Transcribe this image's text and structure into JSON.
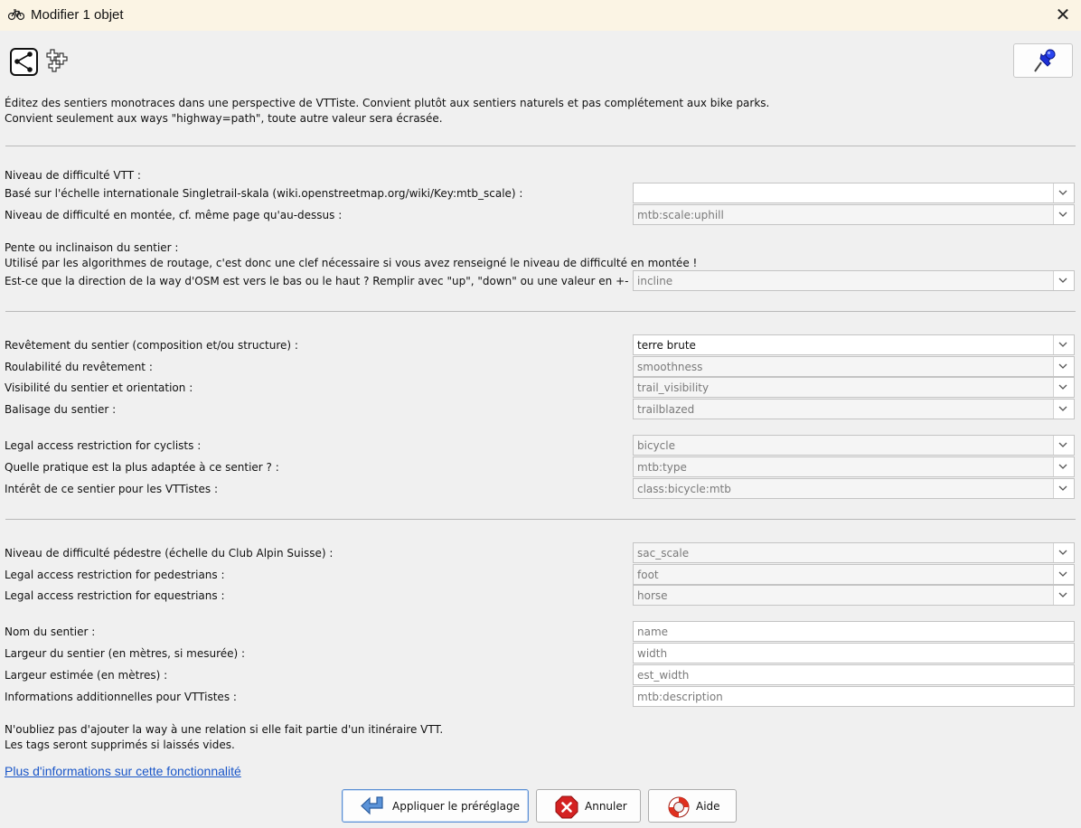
{
  "window": {
    "title": "Modifier 1 objet",
    "close_glyph": "✕",
    "icon": "bicycle-icon"
  },
  "toolbar": {
    "icons": [
      "way-nodes-icon",
      "add-tags-icon"
    ],
    "pin_icon": "pushpin-icon"
  },
  "description": {
    "line1": "Éditez des sentiers monotraces dans une perspective de VTTiste. Convient plutôt aux sentiers naturels et pas complétement aux bike parks.",
    "line2": "Convient seulement aux ways \"highway=path\", toute autre valeur sera écrasée."
  },
  "section_vtt": {
    "heading": "Niveau de difficulté VTT :",
    "mtb_scale": {
      "label": "Basé sur l'échelle internationale Singletrail-skala (wiki.openstreetmap.org/wiki/Key:mtb_scale) :",
      "value": ""
    },
    "mtb_uphill": {
      "label": "Niveau de difficulté en montée, cf. même page qu'au-dessus :",
      "placeholder": "mtb:scale:uphill"
    }
  },
  "section_incline": {
    "heading": "Pente ou inclinaison du sentier :",
    "note": "Utilisé par les algorithmes de routage, c'est donc une clef nécessaire si vous avez renseigné le niveau de difficulté en montée !",
    "incline": {
      "label": "Est-ce que la direction de la way d'OSM est vers le bas ou le haut ? Remplir avec \"up\", \"down\" ou une valeur en +- % :",
      "placeholder": "incline"
    }
  },
  "section_surface": {
    "surface": {
      "label": "Revêtement du sentier (composition et/ou structure) :",
      "value": "terre brute"
    },
    "smoothness": {
      "label": "Roulabilité du revêtement :",
      "placeholder": "smoothness"
    },
    "trail_visibility": {
      "label": "Visibilité du sentier et orientation :",
      "placeholder": "trail_visibility"
    },
    "trailblazed": {
      "label": "Balisage du sentier :",
      "placeholder": "trailblazed"
    },
    "bicycle": {
      "label": "Legal access restriction for cyclists :",
      "placeholder": "bicycle"
    },
    "mtb_type": {
      "label": "Quelle pratique est la plus adaptée à ce sentier ? :",
      "placeholder": "mtb:type"
    },
    "class_mtb": {
      "label": "Intérêt de ce sentier pour les VTTistes :",
      "placeholder": "class:bicycle:mtb"
    }
  },
  "section_pedestrian": {
    "sac_scale": {
      "label": "Niveau de difficulté pédestre (échelle du Club Alpin Suisse) :",
      "placeholder": "sac_scale"
    },
    "foot": {
      "label": "Legal access restriction for pedestrians :",
      "placeholder": "foot"
    },
    "horse": {
      "label": "Legal access restriction for equestrians :",
      "placeholder": "horse"
    }
  },
  "section_text": {
    "name": {
      "label": "Nom du sentier :",
      "placeholder": "name"
    },
    "width": {
      "label": "Largeur du sentier (en mètres, si mesurée) :",
      "placeholder": "width"
    },
    "est_width": {
      "label": "Largeur estimée (en mètres) :",
      "placeholder": "est_width"
    },
    "mtb_description": {
      "label": "Informations additionnelles pour VTTistes :",
      "placeholder": "mtb:description"
    }
  },
  "footer_notes": {
    "line1": "N'oubliez pas d'ajouter la way à une relation si elle fait partie d'un itinéraire VTT.",
    "line2": "Les tags seront supprimés si laissés vides."
  },
  "more_info_link": "Plus d'informations sur cette fonctionnalité",
  "buttons": {
    "apply": {
      "label": "Appliquer le préréglage",
      "icon": "apply-arrow-icon"
    },
    "cancel": {
      "label": "Annuler",
      "icon": "cancel-icon"
    },
    "help": {
      "label": "Aide",
      "icon": "help-lifebuoy-icon"
    }
  },
  "colors": {
    "title_bar": "#fbf4e4",
    "background": "#f0f0f0",
    "link": "#1a56c8",
    "pin": "#1c2fd6",
    "cancel_red": "#d42222",
    "help_red": "#e0301e",
    "apply_blue": "#3d79c7"
  }
}
